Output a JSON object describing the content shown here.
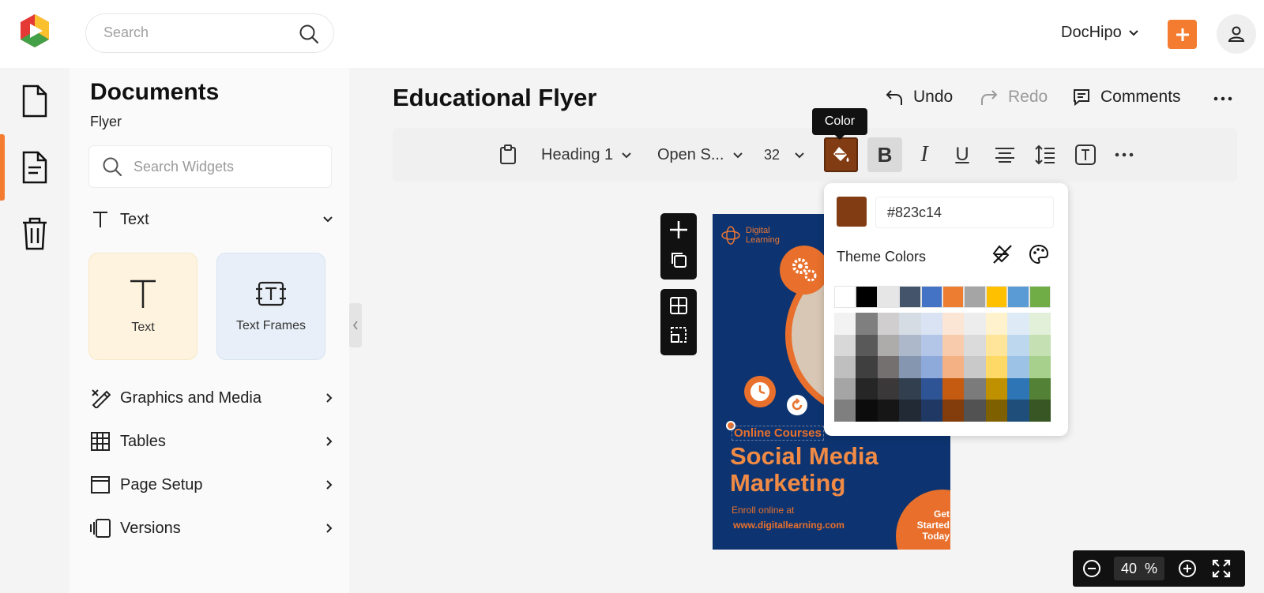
{
  "header": {
    "search_placeholder": "Search",
    "workspace": "DocHipo",
    "brand_colors": {
      "accent": "#f47c30",
      "red": "#e53935",
      "green": "#43a047",
      "yellow": "#fbc02d"
    }
  },
  "rail": {
    "items": [
      {
        "icon": "document-icon"
      },
      {
        "icon": "file-text-icon",
        "active": true
      },
      {
        "icon": "trash-icon"
      }
    ]
  },
  "panel": {
    "title": "Documents",
    "subtitle": "Flyer",
    "search_placeholder": "Search Widgets",
    "text_section": "Text",
    "cards": [
      {
        "label": "Text",
        "icon": "text-icon"
      },
      {
        "label": "Text Frames",
        "icon": "text-frame-icon"
      }
    ],
    "sections": [
      {
        "label": "Graphics and Media",
        "icon": "graphics-icon"
      },
      {
        "label": "Tables",
        "icon": "table-icon"
      },
      {
        "label": "Page Setup",
        "icon": "page-setup-icon"
      },
      {
        "label": "Versions",
        "icon": "versions-icon"
      }
    ]
  },
  "document": {
    "title": "Educational Flyer",
    "actions": {
      "undo": "Undo",
      "redo": "Redo",
      "comments": "Comments"
    }
  },
  "toolbar": {
    "style": "Heading 1",
    "font": "Open S...",
    "size": "32",
    "tooltip": "Color",
    "bold": "B",
    "italic": "I",
    "underline": "U"
  },
  "flyer": {
    "brand_line1": "Digital",
    "brand_line2": "Learning",
    "online": "Online Courses",
    "headline_line1": "Social Media",
    "headline_line2": "Marketing",
    "enroll": "Enroll online at",
    "url": "www.digitallearning.com",
    "cta_line1": "Get",
    "cta_line2": "Started",
    "cta_line3": "Today",
    "colors": {
      "bg": "#0d3470",
      "orange": "#e8702c"
    }
  },
  "color_picker": {
    "current": "#823c14",
    "hex_value": "#823c14",
    "theme_label": "Theme Colors",
    "theme_colors": [
      "#ffffff",
      "#000000",
      "#e7e6e6",
      "#44546a",
      "#4472c4",
      "#ed7d31",
      "#a5a5a5",
      "#ffc000",
      "#5b9bd5",
      "#70ad47"
    ],
    "shades": [
      [
        "#f2f2f2",
        "#7f7f7f",
        "#d0cece",
        "#d6dce4",
        "#dae3f3",
        "#fbe5d5",
        "#ededed",
        "#fff2cc",
        "#deebf6",
        "#e2efd9"
      ],
      [
        "#d8d8d8",
        "#595959",
        "#aeabab",
        "#adb9ca",
        "#b4c6e7",
        "#f7cbac",
        "#dbdbdb",
        "#fee599",
        "#bdd7ee",
        "#c5e0b3"
      ],
      [
        "#bfbfbf",
        "#3f3f3f",
        "#757070",
        "#8496b0",
        "#8eaadb",
        "#f4b183",
        "#c9c9c9",
        "#ffd965",
        "#9cc3e5",
        "#a8d08d"
      ],
      [
        "#a5a5a5",
        "#262626",
        "#3a3838",
        "#323f4f",
        "#2f5496",
        "#c55a11",
        "#7b7b7b",
        "#bf9000",
        "#2e75b5",
        "#538135"
      ],
      [
        "#7f7f7f",
        "#0c0c0c",
        "#171616",
        "#222a35",
        "#1f3864",
        "#833c0b",
        "#525252",
        "#7f6000",
        "#1e4e79",
        "#375623"
      ]
    ]
  },
  "zoom": {
    "value": "40",
    "unit": "%"
  }
}
